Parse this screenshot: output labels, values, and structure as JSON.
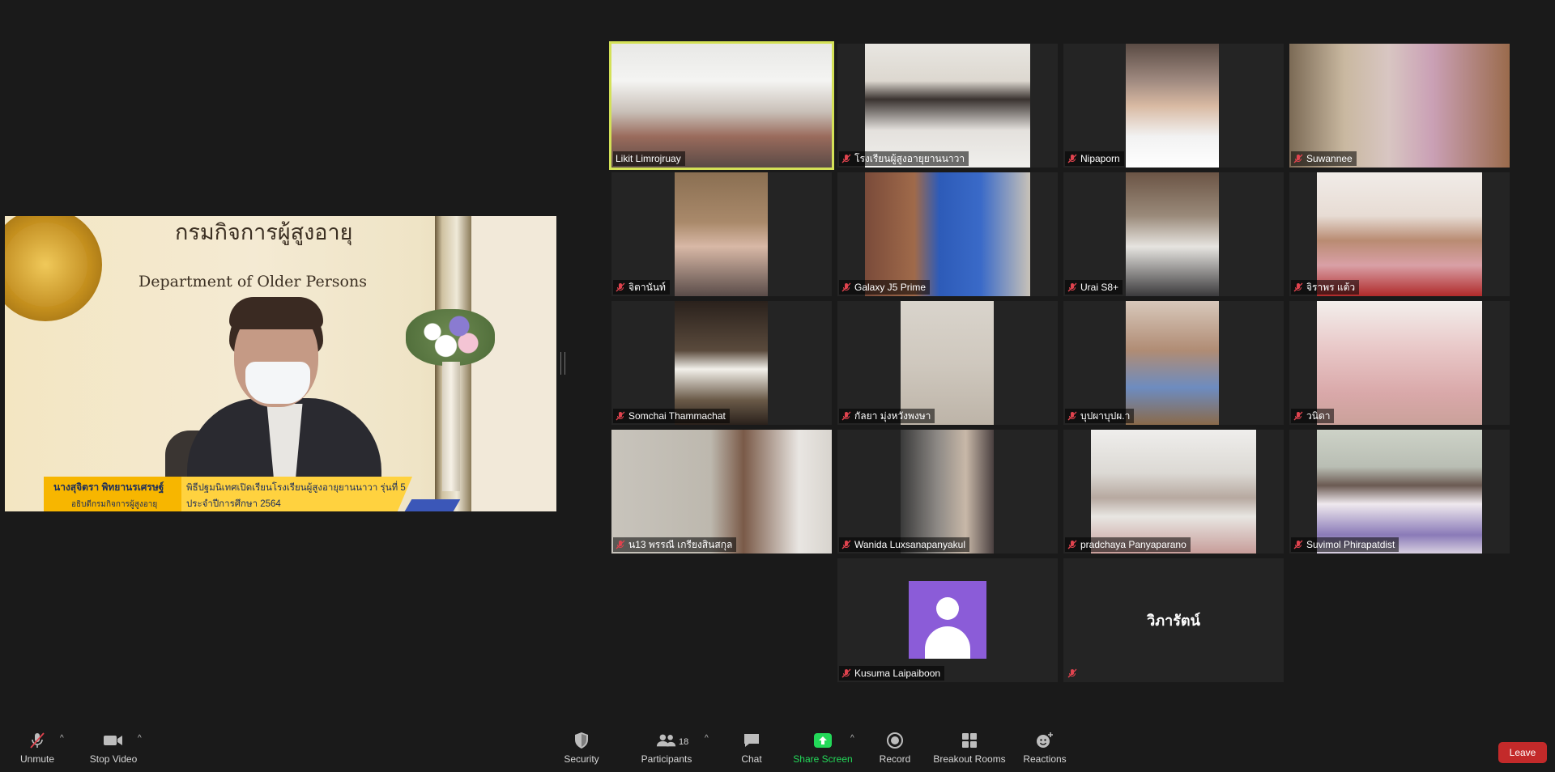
{
  "shared_screen": {
    "org_name_th": "กรมกิจการผู้สูงอายุ",
    "org_name_en": "Department of Older Persons",
    "speaker_name": "นางสุจิตรา พิทยานรเศรษฐ์",
    "speaker_role": "อธิบดีกรมกิจการผู้สูงอายุ",
    "event_title": "พิธีปฐมนิเทศเปิดเรียนโรงเรียนผู้สูงอายุยานนาวา รุ่นที่ 5",
    "event_year": "ประจำปีการศึกษา 2564"
  },
  "participants": [
    {
      "name": "Likit Limrojruay",
      "muted": false,
      "active": true
    },
    {
      "name": "โรงเรียนผู้สูงอายุยานนาวา",
      "muted": true
    },
    {
      "name": "Nipaporn",
      "muted": true
    },
    {
      "name": "Suwannee",
      "muted": true
    },
    {
      "name": "จิตานันท์",
      "muted": true
    },
    {
      "name": "Galaxy J5 Prime",
      "muted": true
    },
    {
      "name": "Urai S8+",
      "muted": true
    },
    {
      "name": "จิราพร แต้ว",
      "muted": true
    },
    {
      "name": "Somchai Thammachat",
      "muted": true
    },
    {
      "name": "กัลยา มุ่งหวังพงษา",
      "muted": true
    },
    {
      "name": "บุปผาบุปผ.า",
      "muted": true
    },
    {
      "name": "วนิดา",
      "muted": true
    },
    {
      "name": "น13 พรรณี เกรียงสินสกุล",
      "muted": true
    },
    {
      "name": "Wanida Luxsanapanyakul",
      "muted": true
    },
    {
      "name": "pradchaya Panyaparano",
      "muted": true
    },
    {
      "name": "Suvimol Phirapatdist",
      "muted": true
    },
    {
      "name": "Kusuma Laipaiboon",
      "muted": true,
      "video_off": true
    },
    {
      "name": "",
      "display_name": "วิภารัตน์",
      "muted": true,
      "video_off": true
    }
  ],
  "toolbar": {
    "unmute": "Unmute",
    "stop_video": "Stop Video",
    "security": "Security",
    "participants": "Participants",
    "participants_count": "18",
    "chat": "Chat",
    "share_screen": "Share Screen",
    "record": "Record",
    "breakout_rooms": "Breakout Rooms",
    "reactions": "Reactions",
    "leave": "Leave"
  },
  "colors": {
    "background": "#1a1a1a",
    "active_speaker_border": "#d4e157",
    "share_screen_green": "#23d959",
    "leave_red": "#c32a2a",
    "avatar_purple": "#8b5cd8",
    "mic_off_red": "#e0434e"
  },
  "icons": {
    "unmute": "mic-off-icon",
    "stop_video": "video-camera-icon",
    "security": "shield-icon",
    "participants": "people-icon",
    "chat": "chat-bubble-icon",
    "share_screen": "share-arrow-icon",
    "record": "record-icon",
    "breakout_rooms": "grid-icon",
    "reactions": "smiley-plus-icon"
  }
}
